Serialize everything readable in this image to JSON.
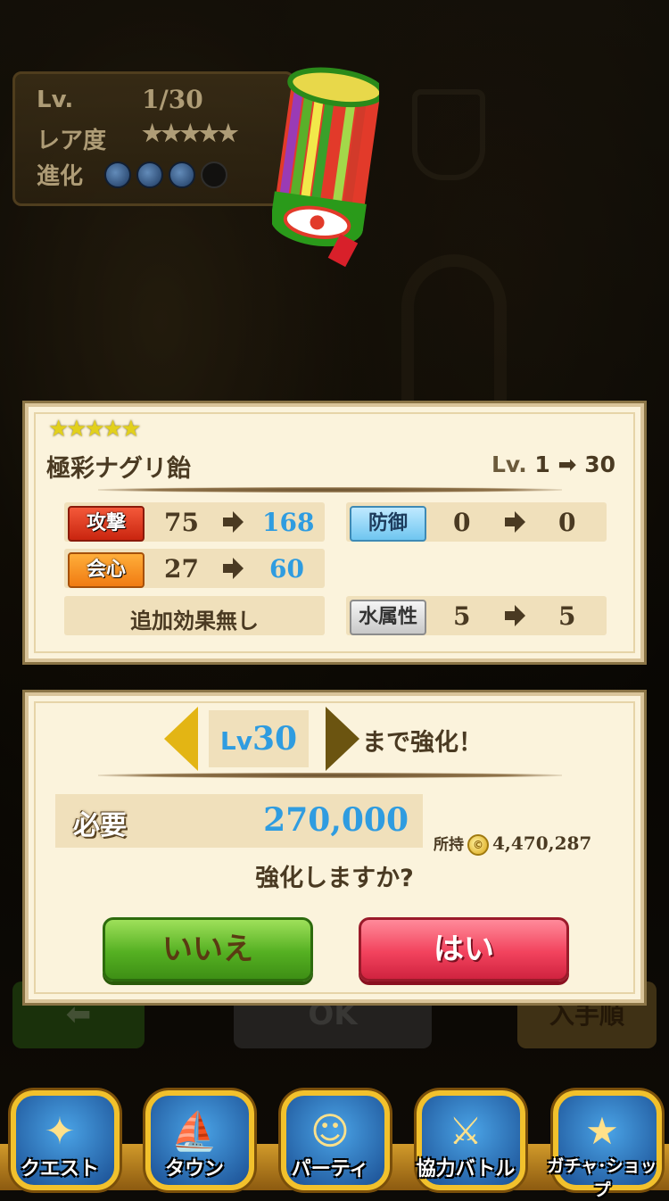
{
  "item_info": {
    "lv_label": "Lv.",
    "lv_value": "1/30",
    "rarity_label": "レア度",
    "rarity_stars": "★★★★★",
    "evolution_label": "進化",
    "evolution_level": 3,
    "evolution_max": 4
  },
  "item_icon": "candy-drum-icon",
  "detail": {
    "stars": "★★★★★",
    "name": "極彩ナグリ飴",
    "lv_prefix": "Lv.",
    "lv_from": "1",
    "lv_to": "30",
    "stats": {
      "attack": {
        "label": "攻撃",
        "from": "75",
        "to": "168"
      },
      "defense": {
        "label": "防御",
        "from": "0",
        "to": "0"
      },
      "critical": {
        "label": "会心",
        "from": "27",
        "to": "60"
      },
      "extra_effect": "追加効果無し",
      "water": {
        "label": "水属性",
        "from": "5",
        "to": "5"
      }
    }
  },
  "enhance": {
    "lv_prefix": "Lv",
    "lv_value": "30",
    "until_text": "まで強化！",
    "need_label": "必要",
    "need_value": "270,000",
    "owned_label": "所持",
    "coin_symbol": "©",
    "owned_value": "4,470,287",
    "question": "強化しますか?",
    "no_label": "いいえ",
    "yes_label": "はい"
  },
  "background_buttons": {
    "ok_label": "OK",
    "sort_label": "入手順"
  },
  "nav": [
    {
      "label": "クエスト",
      "icon": "quest-map-icon",
      "glyph": "✦"
    },
    {
      "label": "タウン",
      "icon": "town-ship-icon",
      "glyph": "⛵"
    },
    {
      "label": "パーティ",
      "icon": "party-members-icon",
      "glyph": "☺"
    },
    {
      "label": "協力バトル",
      "icon": "coop-battle-shield-icon",
      "glyph": "⚔"
    },
    {
      "label": "ガチャ･ショップ",
      "icon": "gacha-star-icon",
      "glyph": "★"
    }
  ],
  "colors": {
    "accent_blue": "#2f9ce0",
    "yes_button": "#f2435d",
    "no_button": "#55b022",
    "card_bg": "#fbf3dc"
  }
}
